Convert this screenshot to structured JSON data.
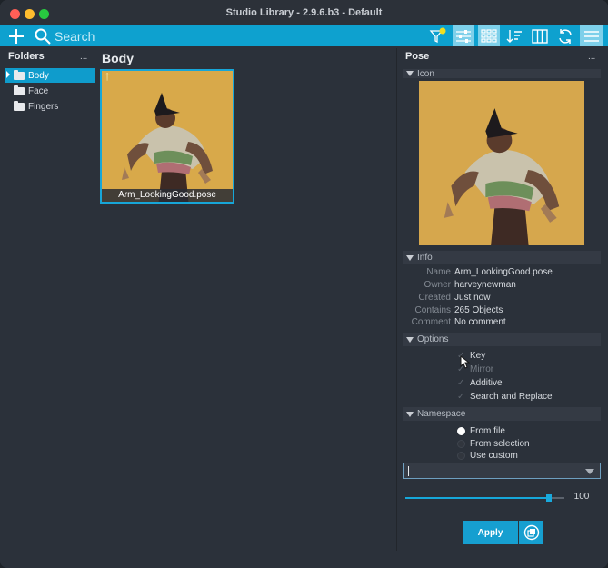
{
  "window": {
    "title": "Studio Library - 2.9.6.b3 - Default"
  },
  "toolbar": {
    "search_placeholder": "Search",
    "icons": [
      "plus-icon",
      "search-icon",
      "filter-icon",
      "sliders-icon",
      "grid-icon",
      "sort-icon",
      "columns-icon",
      "refresh-icon",
      "menu-icon"
    ],
    "accent": "#0ea1cf"
  },
  "folders": {
    "heading": "Folders",
    "menu": "...",
    "items": [
      {
        "label": "Body",
        "selected": true
      },
      {
        "label": "Face",
        "selected": false
      },
      {
        "label": "Fingers",
        "selected": false
      }
    ]
  },
  "main": {
    "heading": "Body",
    "items": [
      {
        "label": "Arm_LookingGood.pose"
      }
    ]
  },
  "pose": {
    "heading": "Pose",
    "menu": "...",
    "icon_section": "Icon",
    "info_section": "Info",
    "info": [
      {
        "key": "Name",
        "value": "Arm_LookingGood.pose"
      },
      {
        "key": "Owner",
        "value": "harveynewman"
      },
      {
        "key": "Created",
        "value": "Just now"
      },
      {
        "key": "Contains",
        "value": "265 Objects"
      },
      {
        "key": "Comment",
        "value": "No comment"
      }
    ],
    "options_section": "Options",
    "options": [
      {
        "label": "Key",
        "dim": false
      },
      {
        "label": "Mirror",
        "dim": true
      },
      {
        "label": "Additive",
        "dim": false
      },
      {
        "label": "Search and Replace",
        "dim": false
      }
    ],
    "namespace_section": "Namespace",
    "namespace": [
      {
        "label": "From file",
        "selected": true
      },
      {
        "label": "From selection",
        "selected": false
      },
      {
        "label": "Use custom",
        "selected": false
      }
    ],
    "namespace_value": "",
    "blend_value": "100",
    "blend_level": 0.9,
    "apply_label": "Apply"
  }
}
